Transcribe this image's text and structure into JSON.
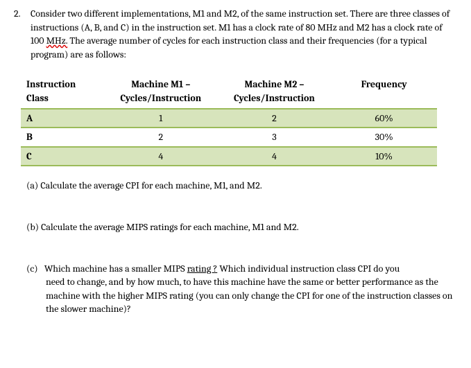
{
  "problem": {
    "number": "2.",
    "intro_1": "Consider two different implementations, M1 and M2, of the same instruction set. There are three classes of instructions (A, B, and C) in the instruction set. M1 has a clock rate of 80 MHz and M2 has a clock rate of 100 ",
    "intro_mhz": "MHz.",
    "intro_2": " The average number of cycles for each instruction class and their frequencies (for a typical program) are as follows:"
  },
  "table": {
    "headers": {
      "class": "Instruction Class",
      "m1": "Machine M1 – Cycles/Instruction",
      "m2": "Machine M2 – Cycles/Instruction",
      "freq": "Frequency"
    },
    "rows": [
      {
        "class": "A",
        "m1": "1",
        "m2": "2",
        "freq": "60%"
      },
      {
        "class": "B",
        "m1": "2",
        "m2": "3",
        "freq": "30%"
      },
      {
        "class": "C",
        "m1": "4",
        "m2": "4",
        "freq": "10%"
      }
    ]
  },
  "parts": {
    "a": {
      "label": "(a)",
      "text": "Calculate the average CPI for each machine, M1, and M2."
    },
    "b": {
      "label": "(b)",
      "text": "Calculate the average MIPS ratings for each machine, M1 and M2."
    },
    "c": {
      "label": "(c)",
      "text_1": "Which machine has a smaller MIPS ",
      "rating": "rating ?",
      "text_2": " Which individual instruction class CPI do you need to change, and by how much, to have this machine have the same or better performance as the machine with the higher MIPS rating (you can only change the CPI for one of the instruction classes on the slower machine)?"
    }
  },
  "chart_data": {
    "type": "table",
    "columns": [
      "Instruction Class",
      "Machine M1 – Cycles/Instruction",
      "Machine M2 – Cycles/Instruction",
      "Frequency"
    ],
    "rows": [
      [
        "A",
        1,
        2,
        "60%"
      ],
      [
        "B",
        2,
        3,
        "30%"
      ],
      [
        "C",
        4,
        4,
        "10%"
      ]
    ],
    "context": {
      "M1_clock_MHz": 80,
      "M2_clock_MHz": 100
    }
  }
}
